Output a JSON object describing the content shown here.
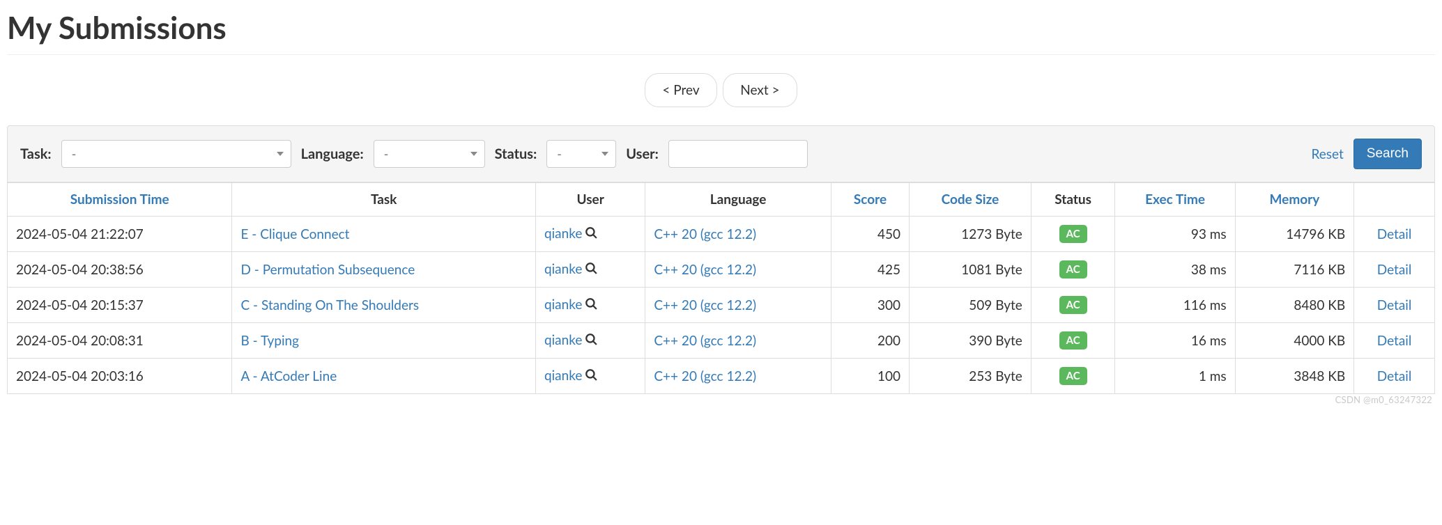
{
  "title": "My Submissions",
  "pager": {
    "prev": "< Prev",
    "next": "Next >"
  },
  "filter": {
    "task_label": "Task:",
    "task_value": "-",
    "language_label": "Language:",
    "language_value": "-",
    "status_label": "Status:",
    "status_value": "-",
    "user_label": "User:",
    "user_value": "",
    "reset": "Reset",
    "search": "Search"
  },
  "headers": {
    "submission_time": "Submission Time",
    "task": "Task",
    "user": "User",
    "language": "Language",
    "score": "Score",
    "code_size": "Code Size",
    "status": "Status",
    "exec_time": "Exec Time",
    "memory": "Memory",
    "detail": ""
  },
  "detail_label": "Detail",
  "status_badge": "AC",
  "rows": [
    {
      "time": "2024-05-04 21:22:07",
      "task": "E - Clique Connect",
      "user": "qianke",
      "language": "C++ 20 (gcc 12.2)",
      "score": "450",
      "code_size": "1273 Byte",
      "exec_time": "93 ms",
      "memory": "14796 KB"
    },
    {
      "time": "2024-05-04 20:38:56",
      "task": "D - Permutation Subsequence",
      "user": "qianke",
      "language": "C++ 20 (gcc 12.2)",
      "score": "425",
      "code_size": "1081 Byte",
      "exec_time": "38 ms",
      "memory": "7116 KB"
    },
    {
      "time": "2024-05-04 20:15:37",
      "task": "C - Standing On The Shoulders",
      "user": "qianke",
      "language": "C++ 20 (gcc 12.2)",
      "score": "300",
      "code_size": "509 Byte",
      "exec_time": "116 ms",
      "memory": "8480 KB"
    },
    {
      "time": "2024-05-04 20:08:31",
      "task": "B - Typing",
      "user": "qianke",
      "language": "C++ 20 (gcc 12.2)",
      "score": "200",
      "code_size": "390 Byte",
      "exec_time": "16 ms",
      "memory": "4000 KB"
    },
    {
      "time": "2024-05-04 20:03:16",
      "task": "A - AtCoder Line",
      "user": "qianke",
      "language": "C++ 20 (gcc 12.2)",
      "score": "100",
      "code_size": "253 Byte",
      "exec_time": "1 ms",
      "memory": "3848 KB"
    }
  ],
  "watermark": "CSDN @m0_63247322"
}
